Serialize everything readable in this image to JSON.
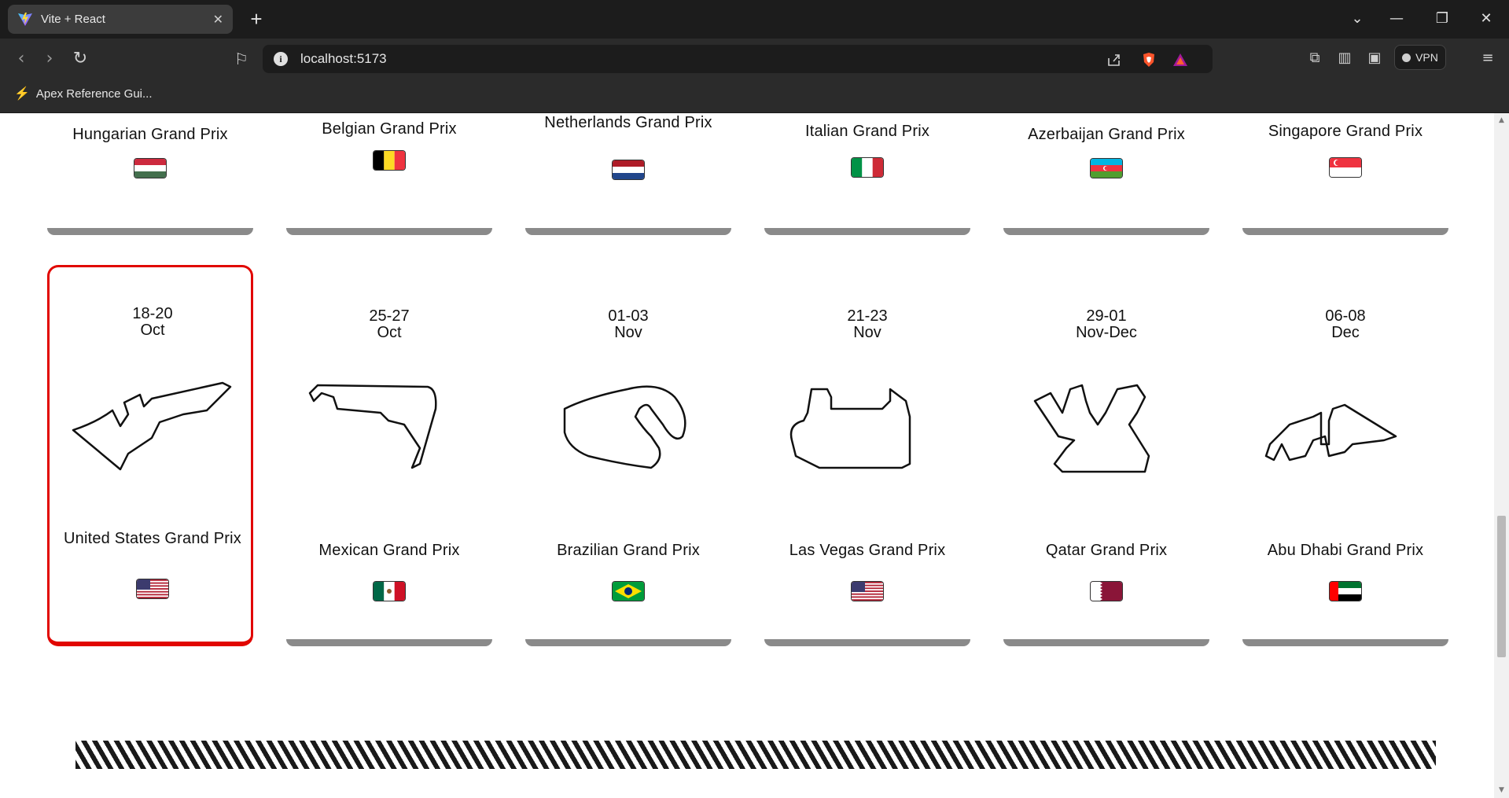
{
  "browser": {
    "tab_title": "Vite + React",
    "tab_close": "✕",
    "new_tab": "+",
    "url": "localhost:5173",
    "vpn_label": "VPN",
    "bookmark_label": "Apex Reference Gui...",
    "window_controls": {
      "dropdown": "⌄",
      "minimize": "—",
      "restore": "❐",
      "close": "✕"
    }
  },
  "top_row": [
    {
      "name": "Hungarian Grand Prix",
      "flag": "hungary"
    },
    {
      "name": "Belgian Grand Prix",
      "flag": "belgium"
    },
    {
      "name": "Netherlands Grand Prix",
      "flag": "netherlands"
    },
    {
      "name": "Italian Grand Prix",
      "flag": "italy"
    },
    {
      "name": "Azerbaijan Grand Prix",
      "flag": "azerbaijan"
    },
    {
      "name": "Singapore Grand Prix",
      "flag": "singapore"
    }
  ],
  "bottom_row": [
    {
      "date": "18-20",
      "month": "Oct",
      "name": "United States Grand Prix",
      "flag": "usa",
      "selected": true
    },
    {
      "date": "25-27",
      "month": "Oct",
      "name": "Mexican Grand Prix",
      "flag": "mexico"
    },
    {
      "date": "01-03",
      "month": "Nov",
      "name": "Brazilian Grand Prix",
      "flag": "brazil"
    },
    {
      "date": "21-23",
      "month": "Nov",
      "name": "Las Vegas Grand Prix",
      "flag": "usa"
    },
    {
      "date": "29-01",
      "month": "Nov-Dec",
      "name": "Qatar Grand Prix",
      "flag": "qatar"
    },
    {
      "date": "06-08",
      "month": "Dec",
      "name": "Abu Dhabi Grand Prix",
      "flag": "uae"
    }
  ],
  "colors": {
    "accent": "#e10600",
    "base": "#8a8a8a"
  }
}
